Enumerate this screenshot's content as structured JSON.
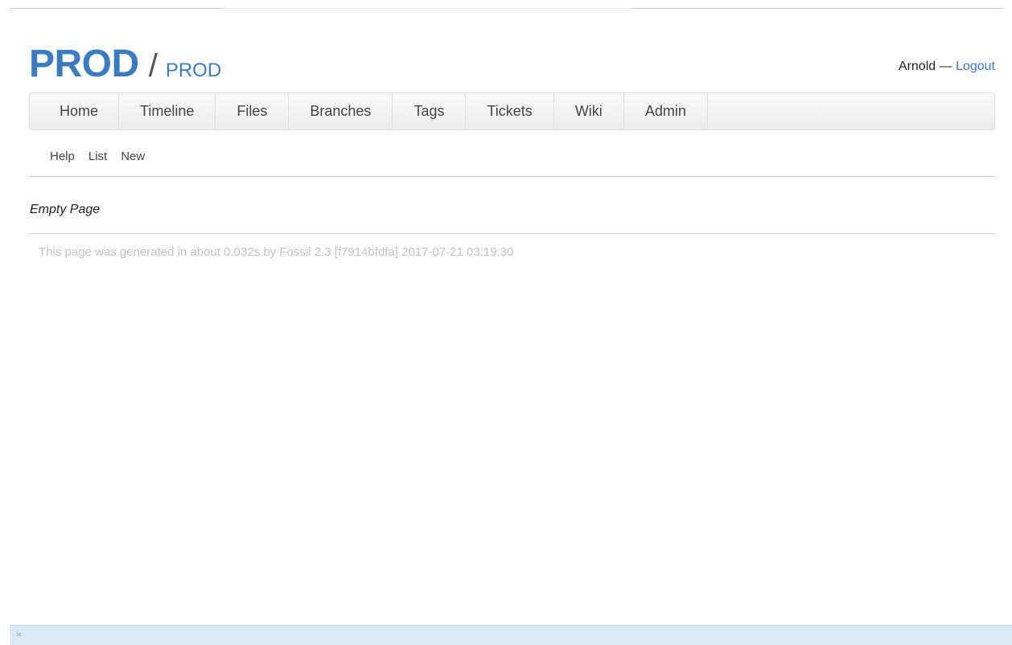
{
  "header": {
    "repo_title": "PROD",
    "separator": "/",
    "subtitle": "PROD",
    "user": "Arnold",
    "login_separator": "—",
    "logout_label": "Logout"
  },
  "main_menu": {
    "items": [
      "Home",
      "Timeline",
      "Files",
      "Branches",
      "Tags",
      "Tickets",
      "Wiki",
      "Admin"
    ]
  },
  "sub_menu": {
    "items": [
      "Help",
      "List",
      "New"
    ]
  },
  "content": {
    "text": "Empty Page"
  },
  "footer": {
    "text": "This page was generated in about 0.032s by Fossil 2.3 [f7914bfdfa] 2017-07-21 03:19:30"
  },
  "bottom_bar": {
    "close_glyph": "×"
  },
  "colors": {
    "accent": "#3b7cc0",
    "footer_text": "#c2c2c2",
    "bottom_bar": "#d9e9f7"
  }
}
